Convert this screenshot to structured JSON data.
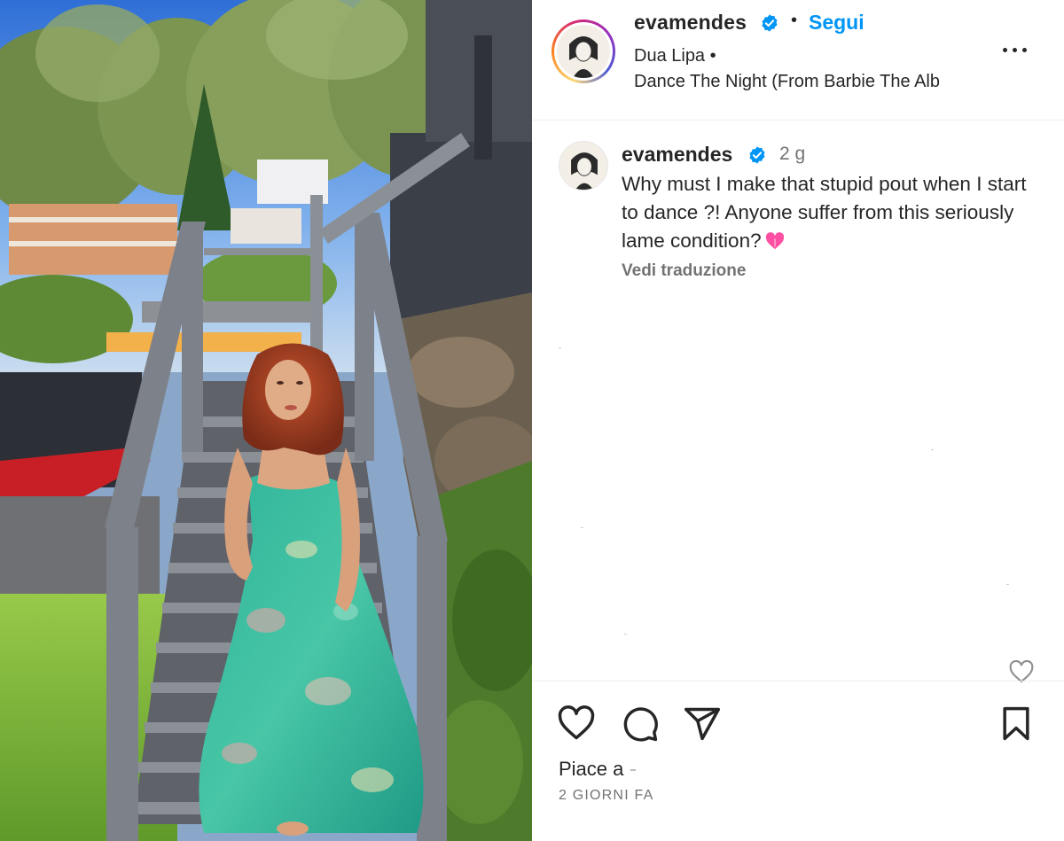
{
  "header": {
    "username": "evamendes",
    "follow_label": "Segui",
    "separator": "•",
    "music_artist": "Dua Lipa •",
    "music_track": "Dance The Night (From Barbie The Alb"
  },
  "caption": {
    "username": "evamendes",
    "time_ago": "2 g",
    "text": "Why must I make that stupid pout when I start to dance ?! Anyone suffer from this seriously lame condition?",
    "translate_label": "Vedi traduzione"
  },
  "footer": {
    "likes_label": "Piace a",
    "date_label": "2 GIORNI FA"
  },
  "icons": {
    "verified": "verified-badge-icon",
    "more": "more-options-icon",
    "like": "heart-icon",
    "comment": "comment-icon",
    "share": "share-icon",
    "save": "bookmark-icon",
    "caption_emoji": "pink-heart-emoji"
  },
  "colors": {
    "follow": "#0095f6",
    "verified": "#0095f6",
    "text": "#262626",
    "muted": "#737373",
    "emoji": "#ff4fa3"
  }
}
